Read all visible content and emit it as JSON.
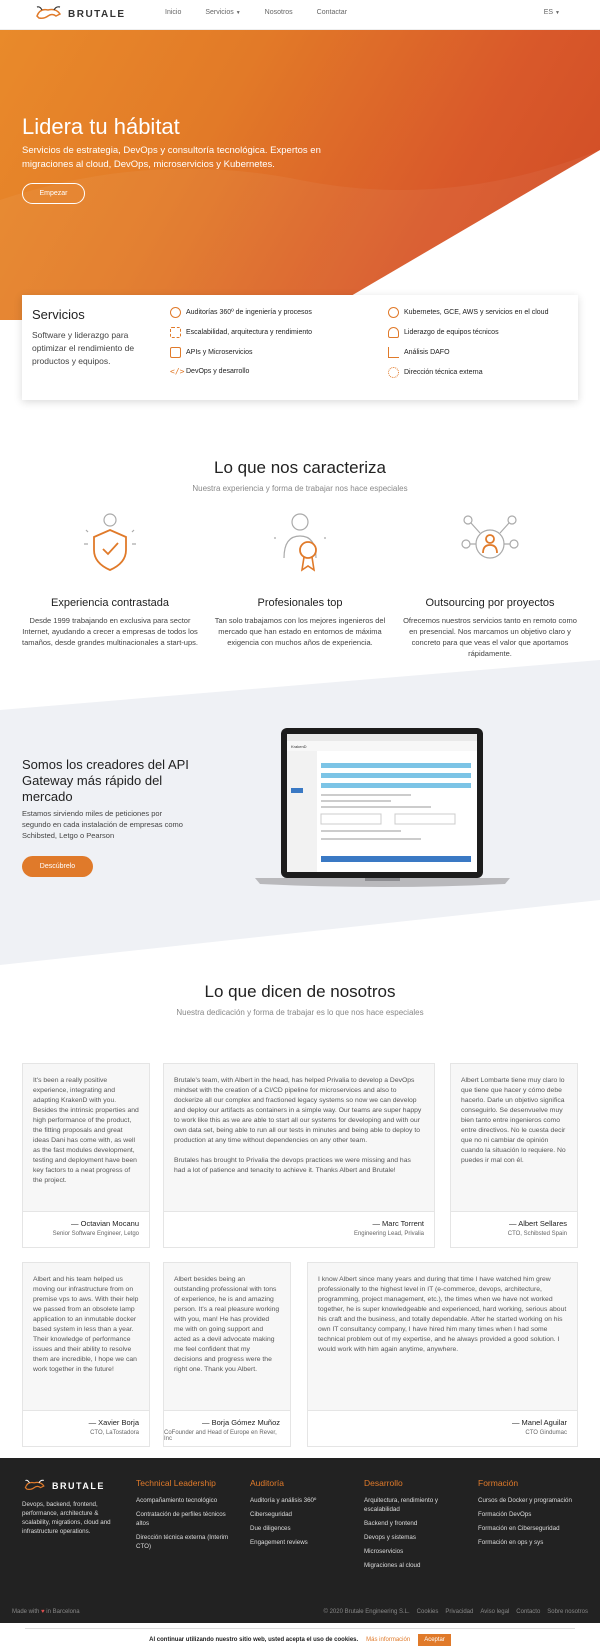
{
  "nav": {
    "brand": "BRUTALE",
    "links": [
      "Inicio",
      "Servicios",
      "Nosotros",
      "Contactar"
    ],
    "lang": "ES"
  },
  "hero": {
    "title": "Lidera tu hábitat",
    "subtitle": "Servicios de estrategia, DevOps y consultoría tecnológica. Expertos en migraciones al cloud, DevOps, microservicios y Kubernetes.",
    "cta": "Empezar"
  },
  "services": {
    "title": "Servicios",
    "desc": "Software y liderazgo para optimizar el rendimiento de productos y equipos.",
    "items": [
      "Auditorías 360º de ingeniería y procesos",
      "Kubernetes, GCE, AWS y servicios en el cloud",
      "Escalabilidad, arquitectura y rendimiento",
      "Liderazgo de equipos técnicos",
      "APIs y Microservicios",
      "Análisis DAFO",
      "DevOps y desarrollo",
      "Dirección técnica externa"
    ]
  },
  "features": {
    "title": "Lo que nos caracteriza",
    "subtitle": "Nuestra experiencia y forma de trabajar nos hace especiales",
    "items": [
      {
        "title": "Experiencia contrastada",
        "text": "Desde 1999 trabajando en exclusiva para sector Internet, ayudando a crecer a empresas de todos los tamaños, desde grandes multinacionales a start-ups."
      },
      {
        "title": "Profesionales top",
        "text": "Tan solo trabajamos con los mejores ingenieros del mercado que han estado en entornos de máxima exigencia con muchos años de experiencia."
      },
      {
        "title": "Outsourcing por proyectos",
        "text": "Ofrecemos nuestros servicios tanto en remoto como en presencial. Nos marcamos un objetivo claro y concreto para que veas el valor que aportamos rápidamente."
      }
    ]
  },
  "api": {
    "title": "Somos los creadores del API Gateway más rápido del mercado",
    "text": "Estamos sirviendo miles de peticiones por segundo en cada instalación de empresas como Schibsted, Letgo o Pearson",
    "cta": "Descúbrelo",
    "screen_brand": "KrakenD"
  },
  "testimonials": {
    "title": "Lo que dicen de nosotros",
    "subtitle": "Nuestra dedicación y forma de trabajar es lo que nos hace especiales",
    "items": [
      {
        "text": "It's been a really positive experience, integrating and adapting KrakenD with you. Besides the intrinsic properties and high performance of the product, the fitting proposals and great ideas Dani has come with, as well as the fast modules development, testing and deployment have been key factors to a neat progress of the project.",
        "name": "— Octavian Mocanu",
        "role": "Senior Software Engineer, Letgo"
      },
      {
        "text": "Brutale's team, with Albert in the head, has helped Privalia to develop a DevOps mindset with the creation of a CI/CD pipeline for microservices and also to dockerize all our complex and fractioned legacy systems so now we can develop and deploy our artifacts as containers in a simple way. Our teams are super happy to work like this as we are able to start all our systems for developing and with our own data set, being able to run all our tests in minutes and being able to deploy to production at any time without dependencies on any other team.\n\nBrutales has brought to Privalia the devops practices we were missing and has had a lot of patience and tenacity to achieve it. Thanks Albert and Brutale!",
        "name": "— Marc Torrent",
        "role": "Engineering Lead, Privalia"
      },
      {
        "text": "Albert Lombarte tiene muy claro lo que tiene que hacer y cómo debe hacerlo. Darle un objetivo significa conseguirlo. Se desenvuelve muy bien tanto entre ingenieros como entre directivos. No le cuesta decir que no ni cambiar de opinión cuando la situación lo requiere. No puedes ir mal con él.",
        "name": "— Albert Sellares",
        "role": "CTO, Schibsted Spain"
      },
      {
        "text": "Albert and his team helped us moving our infrastructure from on premise vps to aws. With their help we passed from an obsolete lamp application to an inmutable docker based system in less than a year. Their knowledge of performance issues and their ability to resolve them are incredible, I hope we can work together in the future!",
        "name": "— Xavier Borja",
        "role": "CTO, LaTostadora"
      },
      {
        "text": "Albert besides being an outstanding professional with tons of experience, he is and amazing person. It's a real pleasure working with you, man! He has provided me with on going support and acted as a devil advocate making me feel confident that my decisions and progress were the right one. Thank you Albert.",
        "name": "— Borja Gómez Muñoz",
        "role": "CoFounder and Head of Europe en Rever, Inc"
      },
      {
        "text": "I know Albert since many years and during that time I have watched him grew professionally to the highest level in IT (e-commerce, devops, architecture, programming, project management, etc.), the times when we have not worked together, he is super knowledgeable and experienced, hard working, serious about his craft and the business, and totally dependable. After he started working on his own IT consultancy company, I have hired him many times when I had some technical problem out of my expertise, and he always provided a good solution. I would work with him again anytime, anywhere.",
        "name": "— Manel Aguilar",
        "role": "CTO Gindumac"
      }
    ]
  },
  "footer": {
    "brand": "BRUTALE",
    "desc": "Devops, backend, frontend, performance, architecture & scalability, migrations, cloud and infrastructure operations.",
    "cols": [
      {
        "title": "Technical Leadership",
        "items": [
          "Acompañamiento tecnológico",
          "Contratación de perfiles técnicos altos",
          "Dirección técnica externa (Interim CTO)"
        ]
      },
      {
        "title": "Auditoría",
        "items": [
          "Auditoría y análisis 360º",
          "Ciberseguridad",
          "Due diligences",
          "Engagement reviews"
        ]
      },
      {
        "title": "Desarrollo",
        "items": [
          "Arquitectura, rendimiento y escalabilidad",
          "Backend y frontend",
          "Devops y sistemas",
          "Microservicios",
          "Migraciones al cloud"
        ]
      },
      {
        "title": "Formación",
        "items": [
          "Cursos de Docker y programación",
          "Formación DevOps",
          "Formación en Ciberseguridad",
          "Formación en ops y sys"
        ]
      }
    ],
    "made_pre": "Made with",
    "made_post": "in Barcelona",
    "copyright": "© 2020 Brutale Engineering S.L.",
    "links": [
      "Cookies",
      "Privacidad",
      "Aviso legal",
      "Contacto",
      "Sobre nosotros"
    ]
  },
  "cookie": {
    "text": "Al continuar utilizando nuestro sitio web, usted acepta el uso de cookies.",
    "more": "Más información",
    "accept": "Aceptar"
  },
  "colors": {
    "accent": "#e07a2a",
    "footer_bg": "#222222"
  }
}
